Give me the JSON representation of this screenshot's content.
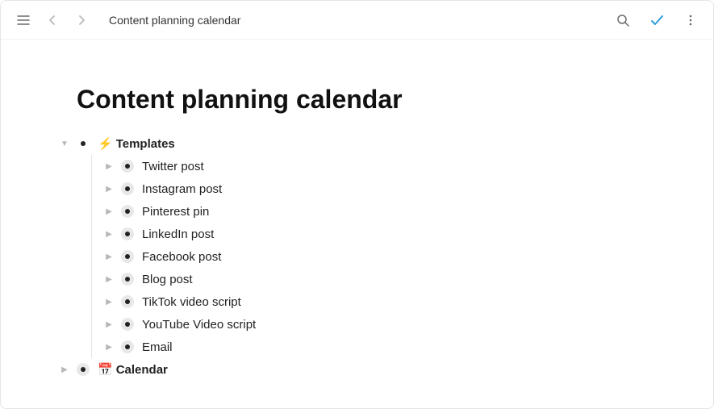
{
  "header": {
    "breadcrumb": "Content planning calendar"
  },
  "page": {
    "title": "Content planning calendar"
  },
  "tree": {
    "templates": {
      "emoji": "⚡",
      "label": "Templates",
      "items": [
        "Twitter post",
        "Instagram post",
        "Pinterest pin",
        "LinkedIn post",
        "Facebook post",
        "Blog post",
        "TikTok video script",
        "YouTube Video script",
        "Email"
      ]
    },
    "calendar": {
      "emoji": "📅",
      "label": "Calendar"
    }
  }
}
